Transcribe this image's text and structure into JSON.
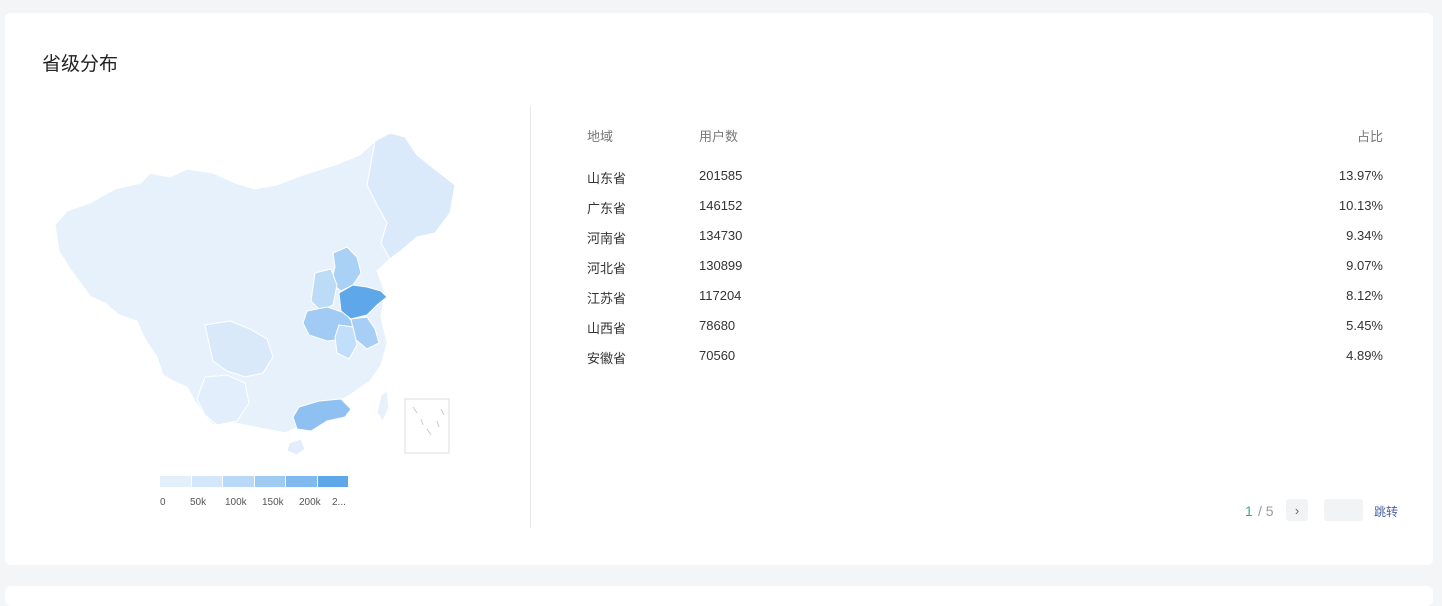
{
  "page": {
    "title": "省级分布"
  },
  "table": {
    "headers": {
      "region": "地域",
      "users": "用户数",
      "ratio": "占比"
    },
    "rows": [
      {
        "region": "山东省",
        "users": "201585",
        "ratio": "13.97%"
      },
      {
        "region": "广东省",
        "users": "146152",
        "ratio": "10.13%"
      },
      {
        "region": "河南省",
        "users": "134730",
        "ratio": "9.34%"
      },
      {
        "region": "河北省",
        "users": "130899",
        "ratio": "9.07%"
      },
      {
        "region": "江苏省",
        "users": "117204",
        "ratio": "8.12%"
      },
      {
        "region": "山西省",
        "users": "78680",
        "ratio": "5.45%"
      },
      {
        "region": "安徽省",
        "users": "70560",
        "ratio": "4.89%"
      }
    ]
  },
  "legend": {
    "labels": [
      "0",
      "50k",
      "100k",
      "150k",
      "200k",
      "2..."
    ],
    "colors": [
      "#e3f0fc",
      "#d2e7fa",
      "#b9daf7",
      "#9fcbf3",
      "#7fb9ef",
      "#5ea8ea"
    ]
  },
  "pagination": {
    "current": "1",
    "separator": "/ 5",
    "next": "›",
    "jump_label": "跳转",
    "jump_value": ""
  },
  "colors": {
    "accent_green": "#3cb371",
    "map_base": "#e7f1fc",
    "map_high": "#5ea8ea"
  }
}
